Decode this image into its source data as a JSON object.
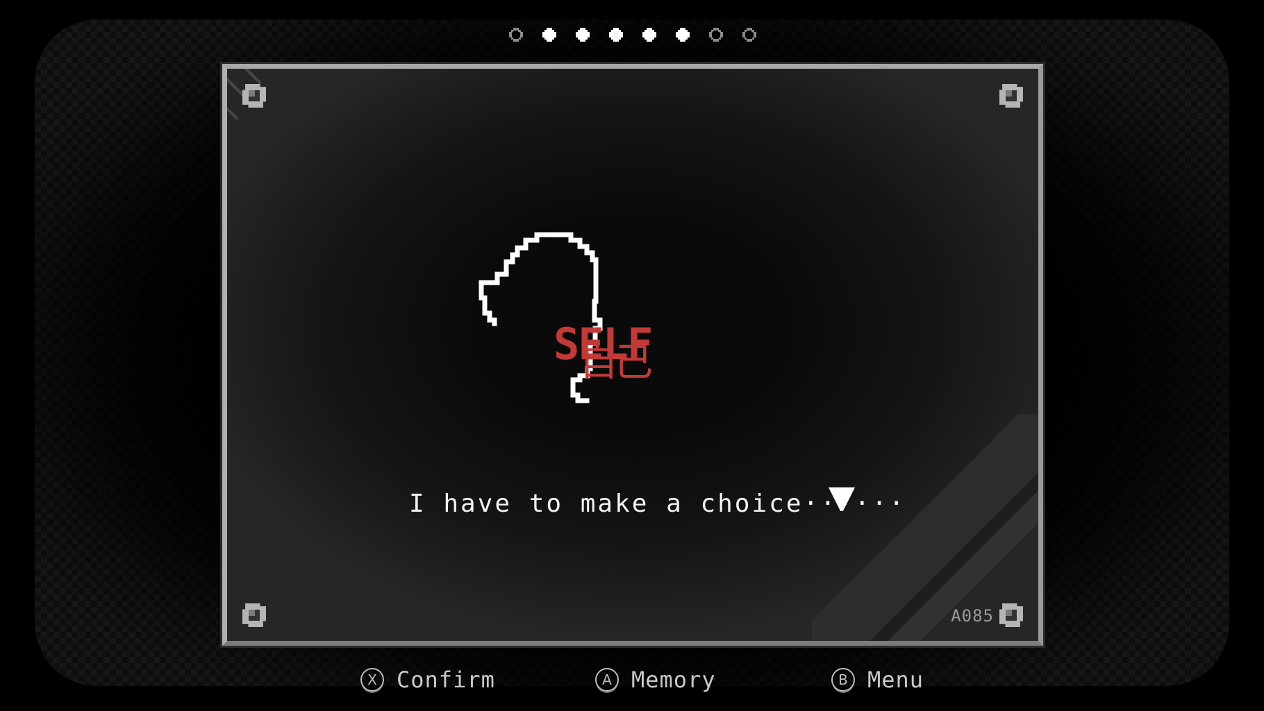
{
  "page_indicator": {
    "total": 8,
    "states": [
      "empty",
      "filled",
      "filled",
      "filled",
      "filled",
      "filled",
      "empty",
      "empty"
    ]
  },
  "panel": {
    "illustration": "head-silhouette-outline",
    "title_en": "SELF",
    "title_jp": "自己",
    "dialogue": "I have to make a choice······",
    "advance_icon": "down-triangle-icon",
    "code": "A085",
    "corner_icons": [
      "bolt-icon",
      "bolt-icon",
      "bolt-icon",
      "bolt-icon"
    ]
  },
  "controls": [
    {
      "button": "X",
      "label": "Confirm"
    },
    {
      "button": "A",
      "label": "Memory"
    },
    {
      "button": "B",
      "label": "Menu"
    }
  ],
  "colors": {
    "accent_red": "#c23a36",
    "text_white": "#f2f2f2",
    "frame_gray": "#a8a8a8",
    "hint_gray": "#c9c9c9"
  }
}
